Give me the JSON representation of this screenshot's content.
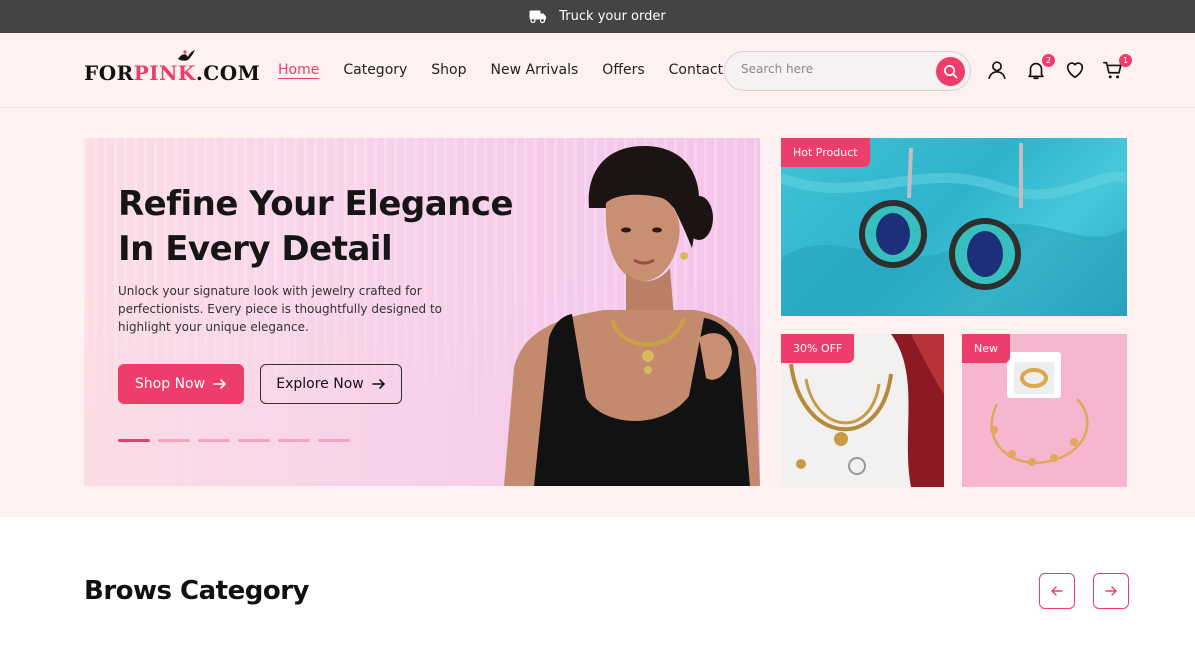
{
  "topbar": {
    "icon": "truck-icon",
    "text": "Truck your order"
  },
  "logo": {
    "part1": "FOR",
    "part2": "PINK",
    "part3": ".COM"
  },
  "nav": [
    {
      "label": "Home",
      "active": true
    },
    {
      "label": "Category"
    },
    {
      "label": "Shop"
    },
    {
      "label": "New Arrivals"
    },
    {
      "label": "Offers"
    },
    {
      "label": "Contact"
    }
  ],
  "search": {
    "placeholder": "Search here",
    "icon": "search-icon"
  },
  "header_icons": {
    "user": "user-icon",
    "notifications": {
      "icon": "bell-icon",
      "count": "2"
    },
    "wishlist": "heart-icon",
    "cart": {
      "icon": "cart-icon",
      "count": "1"
    }
  },
  "hero": {
    "title_line1": "Refine Your Elegance",
    "title_line2": "In Every Detail",
    "description": "Unlock your signature look with jewelry crafted for perfectionists. Every piece is thoughtfully designed to highlight your unique elegance.",
    "primary_button": "Shop Now",
    "secondary_button": "Explore Now",
    "slides_total": 6,
    "active_slide": 1
  },
  "tiles": [
    {
      "tag": "Hot Product"
    },
    {
      "tag": "30% OFF"
    },
    {
      "tag": "New"
    }
  ],
  "category": {
    "title": "Brows Category",
    "prev_icon": "arrow-left-icon",
    "next_icon": "arrow-right-icon"
  },
  "colors": {
    "accent": "#ef3d6b",
    "topbar": "#444444",
    "header_bg": "#fff0f1"
  }
}
